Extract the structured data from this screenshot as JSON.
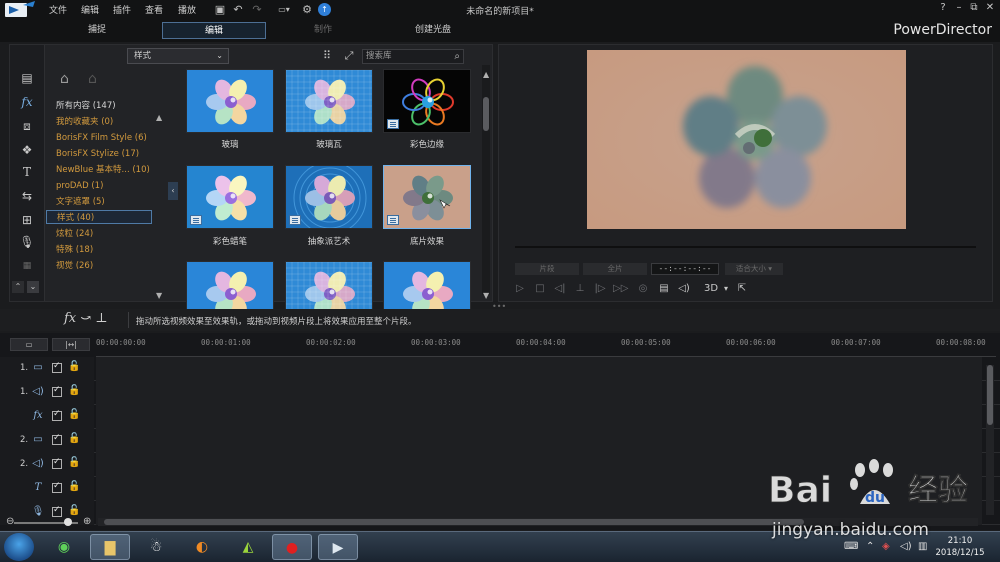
{
  "app": {
    "window_title": "未命名的新项目*",
    "brand": "PowerDirector"
  },
  "menu": [
    "文件",
    "编辑",
    "插件",
    "查看",
    "播放"
  ],
  "mode_tabs": [
    {
      "label": "捕捉",
      "state": "normal"
    },
    {
      "label": "编辑",
      "state": "active"
    },
    {
      "label": "制作",
      "state": "disabled"
    },
    {
      "label": "创建光盘",
      "state": "normal"
    }
  ],
  "library": {
    "style_dropdown": "样式",
    "search_placeholder": "搜索库",
    "categories": [
      {
        "label": "所有内容 (147)",
        "selected": false
      },
      {
        "label": "我的收藏夹 (0)",
        "selected": false
      },
      {
        "label": "BorisFX Film Style (6)",
        "selected": false
      },
      {
        "label": "BorisFX Stylize (17)",
        "selected": false
      },
      {
        "label": "NewBlue 基本特... (10)",
        "selected": false
      },
      {
        "label": "proDAD (1)",
        "selected": false
      },
      {
        "label": "文字遮罩 (5)",
        "selected": false
      },
      {
        "label": "样式 (40)",
        "selected": true
      },
      {
        "label": "炫粒 (24)",
        "selected": false
      },
      {
        "label": "特殊 (18)",
        "selected": false
      },
      {
        "label": "视觉 (26)",
        "selected": false
      }
    ],
    "effects": [
      {
        "label": "玻璃",
        "style": "glass",
        "badge": false,
        "selected": false
      },
      {
        "label": "玻璃瓦",
        "style": "tiles",
        "badge": false,
        "selected": false
      },
      {
        "label": "彩色边缘",
        "style": "edges",
        "badge": true,
        "selected": false
      },
      {
        "label": "彩色蜡笔",
        "style": "crayon",
        "badge": true,
        "selected": false
      },
      {
        "label": "抽象派艺术",
        "style": "abstract",
        "badge": true,
        "selected": false
      },
      {
        "label": "底片效果",
        "style": "negative",
        "badge": true,
        "selected": true
      },
      {
        "label": "",
        "style": "glass",
        "badge": false,
        "selected": false
      },
      {
        "label": "",
        "style": "tiles",
        "badge": false,
        "selected": false
      },
      {
        "label": "",
        "style": "glass",
        "badge": false,
        "selected": false
      }
    ]
  },
  "preview": {
    "clip_button": "片段",
    "movie_button": "全片",
    "timecode": "--:--:--:--",
    "fit_label": "适合大小",
    "mode_3d": "3D"
  },
  "info_bar": {
    "message": "拖动所选视频效果至效果轨，或拖动到视频片段上将效果应用至整个片段。"
  },
  "timeline": {
    "ruler": [
      "00:00:00:00",
      "00:00:01:00",
      "00:00:02:00",
      "00:00:03:00",
      "00:00:04:00",
      "00:00:05:00",
      "00:00:06:00",
      "00:00:07:00",
      "00:00:08:00"
    ],
    "tracks": [
      {
        "num": "1.",
        "icon": "video-track-icon",
        "glyph": "▭"
      },
      {
        "num": "1.",
        "icon": "audio-track-icon",
        "glyph": "◁)"
      },
      {
        "num": "",
        "icon": "fx-track-icon",
        "glyph": "fx"
      },
      {
        "num": "2.",
        "icon": "video-track-icon",
        "glyph": "▭"
      },
      {
        "num": "2.",
        "icon": "audio-track-icon",
        "glyph": "◁)"
      },
      {
        "num": "",
        "icon": "title-track-icon",
        "glyph": "T"
      },
      {
        "num": "",
        "icon": "voice-track-icon",
        "glyph": "🎙"
      }
    ]
  },
  "taskbar": {
    "time": "21:10",
    "date": "2018/12/15"
  },
  "watermark": {
    "url": "jingyan.baidu.com"
  },
  "colors": {
    "accent": "#70b3ec",
    "category": "#d29a3e"
  }
}
